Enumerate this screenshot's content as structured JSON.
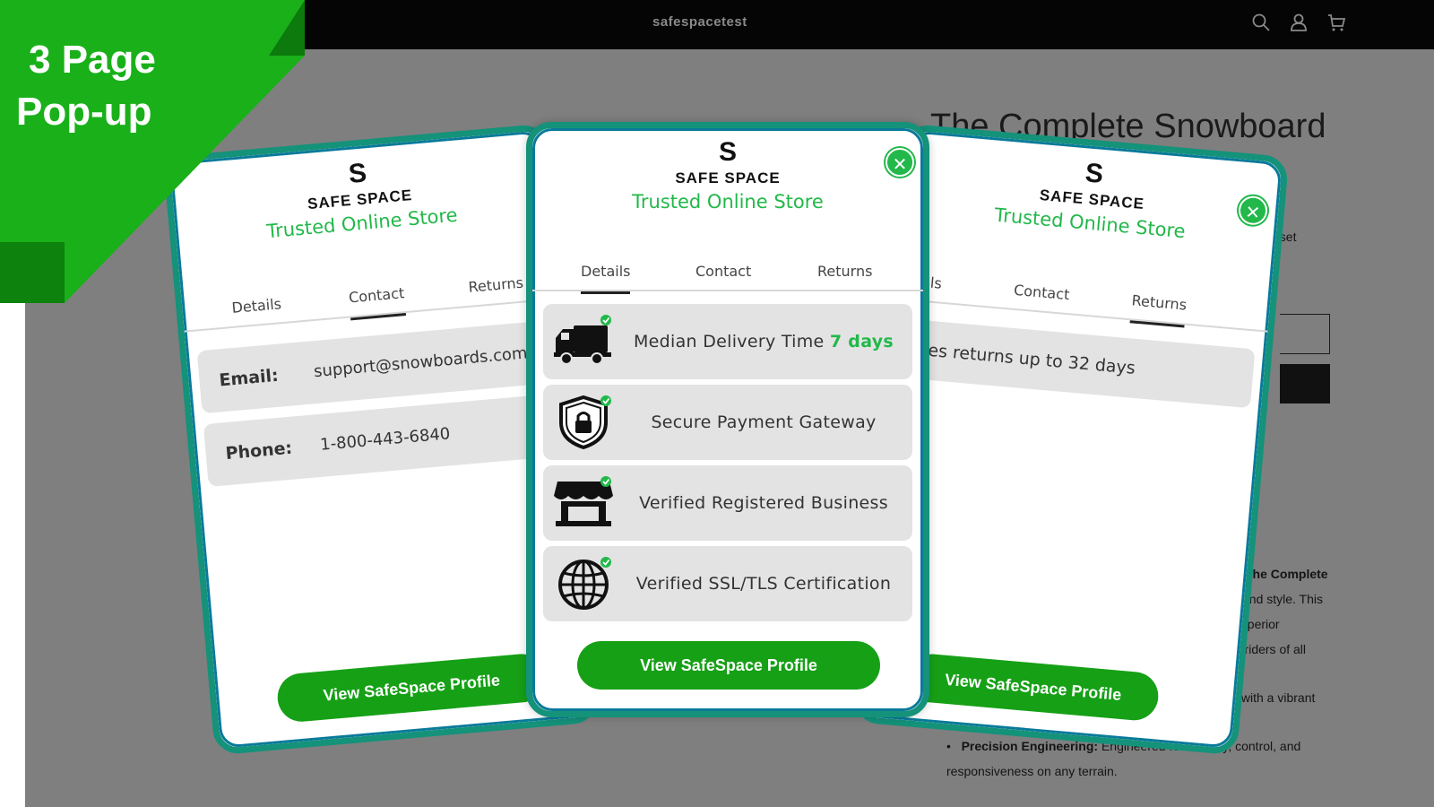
{
  "store": {
    "name": "safespacetest",
    "product_title": "The Complete Snowboard",
    "fragments": {
      "nset": "nset",
      "the_complete": "The Complete",
      "and_style": "and style. This",
      "uperior": "uperior",
      "riders": "r riders of all",
      "vibrant": "s with a vibrant"
    },
    "bullet_label": "Precision Engineering:",
    "bullet_text": "Engineered for stability, control, and",
    "bullet_text2": "responsiveness on any terrain.",
    "header_icons": [
      "search-icon",
      "account-icon",
      "cart-icon"
    ]
  },
  "ribbon": {
    "line1": "3 Page",
    "line2": "Pop-up",
    "color": "#1ab01a"
  },
  "brand": {
    "logo_letter": "S",
    "logo_word": "SAFE SPACE",
    "tagline": "Trusted Online Store",
    "accent_color": "#22b84a",
    "border_color": "#14927a"
  },
  "tabs": [
    "Details",
    "Contact",
    "Returns"
  ],
  "popup_details": {
    "active_tab": "Details",
    "close_icon": "close-icon",
    "rows": [
      {
        "icon": "delivery-truck-icon",
        "label": "Median Delivery Time ",
        "accent": "7 days"
      },
      {
        "icon": "shield-lock-icon",
        "label": "Secure Payment Gateway"
      },
      {
        "icon": "storefront-icon",
        "label": "Verified Registered Business"
      },
      {
        "icon": "globe-icon",
        "label": "Verified SSL/TLS Certification"
      }
    ],
    "cta": "View SafeSpace Profile"
  },
  "popup_contact": {
    "active_tab": "Contact",
    "email_label": "Email:",
    "email_value": "support@snowboards.com",
    "phone_label": "Phone:",
    "phone_value": "1-800-443-6840",
    "cta": "View SafeSpace Profile",
    "tab_labels": [
      "Details",
      "Contact",
      "Returns"
    ]
  },
  "popup_returns": {
    "active_tab": "Returns",
    "returns_text": "Takes returns up to 32 days",
    "cta": "View SafeSpace Profile",
    "tab_labels": [
      "etails",
      "Contact",
      "Returns"
    ]
  }
}
